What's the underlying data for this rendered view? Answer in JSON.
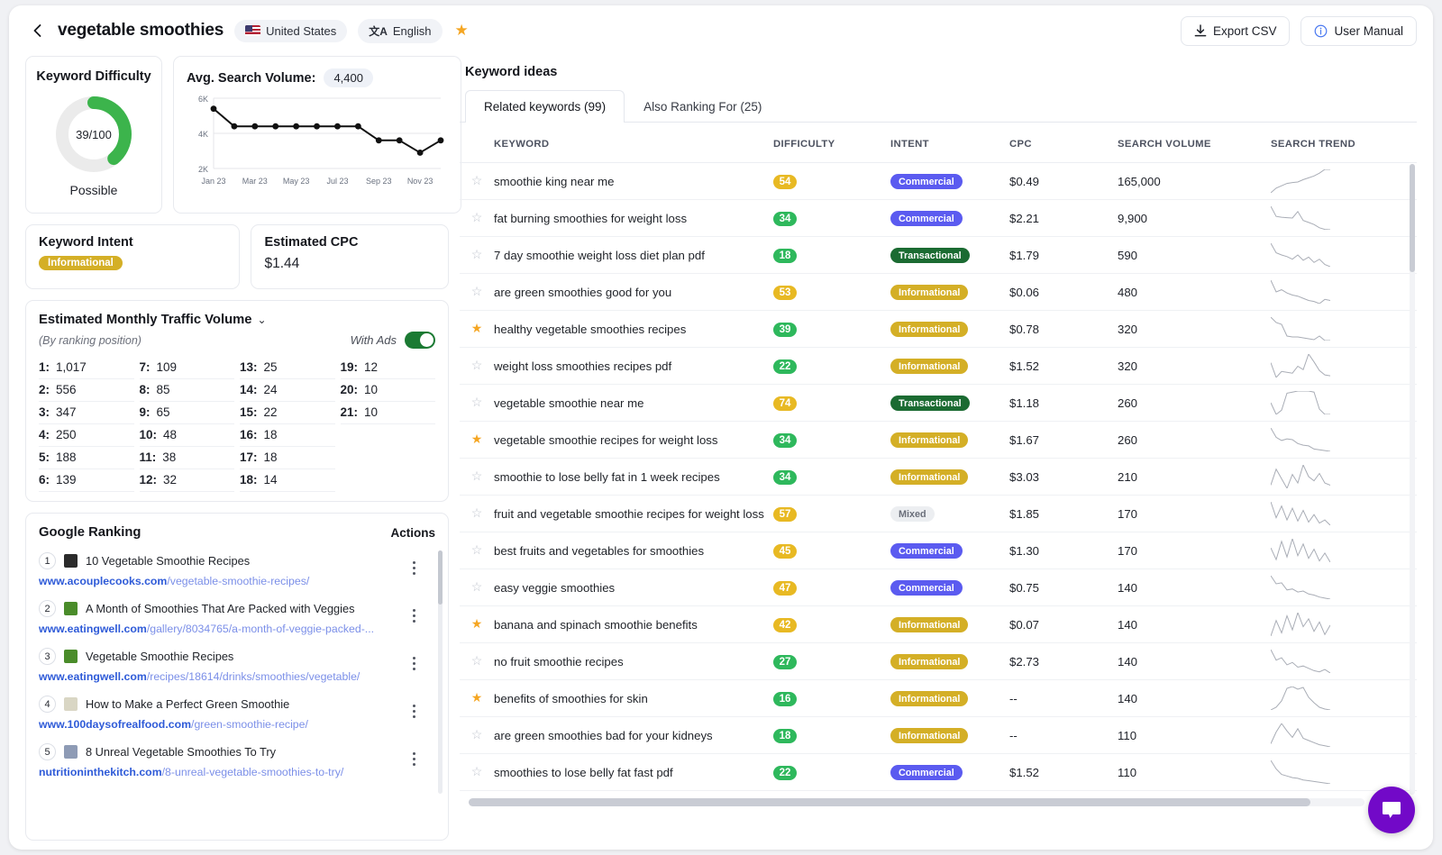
{
  "header": {
    "back_icon": "chevron-left-icon",
    "keyword": "vegetable smoothies",
    "country": "United States",
    "language": "English",
    "favorite_icon": "star-filled-icon",
    "export_label": "Export CSV",
    "manual_label": "User Manual"
  },
  "keyword_difficulty": {
    "title": "Keyword Difficulty",
    "score_text": "39/100",
    "score": 39,
    "verdict": "Possible",
    "arc_color": "#3cb44c",
    "track_color": "#ebebeb"
  },
  "search_volume": {
    "title": "Avg. Search Volume:",
    "value": "4,400"
  },
  "keyword_intent": {
    "title": "Keyword Intent",
    "badge": "Informational",
    "badge_color": "#d4af26"
  },
  "estimated_cpc": {
    "title": "Estimated CPC",
    "value": "$1.44"
  },
  "traffic": {
    "title": "Estimated Monthly Traffic Volume",
    "chevron_icon": "chevron-down-icon",
    "subtitle": "(By ranking position)",
    "ads_label": "With Ads",
    "ads_on": true,
    "columns": [
      [
        {
          "pos": "1:",
          "val": "1,017"
        },
        {
          "pos": "2:",
          "val": "556"
        },
        {
          "pos": "3:",
          "val": "347"
        },
        {
          "pos": "4:",
          "val": "250"
        },
        {
          "pos": "5:",
          "val": "188"
        },
        {
          "pos": "6:",
          "val": "139"
        }
      ],
      [
        {
          "pos": "7:",
          "val": "109"
        },
        {
          "pos": "8:",
          "val": "85"
        },
        {
          "pos": "9:",
          "val": "65"
        },
        {
          "pos": "10:",
          "val": "48"
        },
        {
          "pos": "11:",
          "val": "38"
        },
        {
          "pos": "12:",
          "val": "32"
        }
      ],
      [
        {
          "pos": "13:",
          "val": "25"
        },
        {
          "pos": "14:",
          "val": "24"
        },
        {
          "pos": "15:",
          "val": "22"
        },
        {
          "pos": "16:",
          "val": "18"
        },
        {
          "pos": "17:",
          "val": "18"
        },
        {
          "pos": "18:",
          "val": "14"
        }
      ],
      [
        {
          "pos": "19:",
          "val": "12"
        },
        {
          "pos": "20:",
          "val": "10"
        },
        {
          "pos": "21:",
          "val": "10"
        }
      ]
    ]
  },
  "google_ranking": {
    "title": "Google Ranking",
    "actions_label": "Actions",
    "items": [
      {
        "rank": "1",
        "title": "10 Vegetable Smoothie Recipes",
        "domain": "www.acouplecooks.com",
        "path": "/vegetable-smoothie-recipes/",
        "favicon": "#2b2b2b"
      },
      {
        "rank": "2",
        "title": "A Month of Smoothies That Are Packed with Veggies",
        "domain": "www.eatingwell.com",
        "path": "/gallery/8034765/a-month-of-veggie-packed-...",
        "favicon": "#4a8c2a"
      },
      {
        "rank": "3",
        "title": "Vegetable Smoothie Recipes",
        "domain": "www.eatingwell.com",
        "path": "/recipes/18614/drinks/smoothies/vegetable/",
        "favicon": "#4a8c2a"
      },
      {
        "rank": "4",
        "title": "How to Make a Perfect Green Smoothie",
        "domain": "www.100daysofrealfood.com",
        "path": "/green-smoothie-recipe/",
        "favicon": "#d9d6c4"
      },
      {
        "rank": "5",
        "title": "8 Unreal Vegetable Smoothies To Try",
        "domain": "nutritioninthekitch.com",
        "path": "/8-unreal-vegetable-smoothies-to-try/",
        "favicon": "#8e9bb5"
      }
    ]
  },
  "keyword_ideas": {
    "title": "Keyword ideas",
    "tabs": [
      {
        "label": "Related keywords (99)",
        "active": true
      },
      {
        "label": "Also Ranking For (25)",
        "active": false
      }
    ],
    "columns": [
      "KEYWORD",
      "DIFFICULTY",
      "INTENT",
      "CPC",
      "SEARCH VOLUME",
      "SEARCH TREND"
    ],
    "rows": [
      {
        "starred": false,
        "keyword": "smoothie king near me",
        "difficulty": 54,
        "intent": "Commercial",
        "cpc": "$0.49",
        "volume": "165,000",
        "trend": [
          30,
          40,
          45,
          50,
          52,
          53,
          58,
          62,
          66,
          72,
          80,
          80
        ]
      },
      {
        "starred": false,
        "keyword": "fat burning smoothies for weight loss",
        "difficulty": 34,
        "intent": "Commercial",
        "cpc": "$2.21",
        "volume": "9,900",
        "trend": [
          85,
          60,
          58,
          57,
          56,
          72,
          50,
          45,
          40,
          32,
          28,
          27
        ]
      },
      {
        "starred": false,
        "keyword": "7 day smoothie weight loss diet plan pdf",
        "difficulty": 18,
        "intent": "Transactional",
        "cpc": "$1.79",
        "volume": "590",
        "trend": [
          80,
          62,
          58,
          55,
          50,
          58,
          48,
          54,
          44,
          50,
          40,
          36
        ]
      },
      {
        "starred": false,
        "keyword": "are green smoothies good for you",
        "difficulty": 53,
        "intent": "Informational",
        "cpc": "$0.06",
        "volume": "480",
        "trend": [
          78,
          56,
          60,
          54,
          50,
          48,
          44,
          40,
          38,
          34,
          42,
          40
        ]
      },
      {
        "starred": true,
        "keyword": "healthy vegetable smoothies recipes",
        "difficulty": 39,
        "intent": "Informational",
        "cpc": "$0.78",
        "volume": "320",
        "trend": [
          82,
          70,
          66,
          40,
          38,
          38,
          36,
          34,
          32,
          40,
          30,
          30
        ]
      },
      {
        "starred": false,
        "keyword": "weight loss smoothies recipes pdf",
        "difficulty": 22,
        "intent": "Informational",
        "cpc": "$1.52",
        "volume": "320",
        "trend": [
          68,
          34,
          48,
          46,
          44,
          60,
          52,
          88,
          70,
          50,
          40,
          38
        ]
      },
      {
        "starred": false,
        "keyword": "vegetable smoothie near me",
        "difficulty": 74,
        "intent": "Transactional",
        "cpc": "$1.18",
        "volume": "260",
        "trend": [
          52,
          30,
          38,
          70,
          72,
          74,
          74,
          74,
          72,
          40,
          30,
          30
        ]
      },
      {
        "starred": true,
        "keyword": "vegetable smoothie recipes for weight loss",
        "difficulty": 34,
        "intent": "Informational",
        "cpc": "$1.67",
        "volume": "260",
        "trend": [
          84,
          60,
          52,
          56,
          54,
          44,
          40,
          38,
          30,
          28,
          26,
          24
        ]
      },
      {
        "starred": false,
        "keyword": "smoothie to lose belly fat in 1 week recipes",
        "difficulty": 34,
        "intent": "Informational",
        "cpc": "$3.03",
        "volume": "210",
        "trend": [
          40,
          70,
          52,
          34,
          60,
          44,
          78,
          56,
          48,
          62,
          44,
          40
        ]
      },
      {
        "starred": false,
        "keyword": "fruit and vegetable smoothie recipes for weight loss",
        "difficulty": 57,
        "intent": "Mixed",
        "cpc": "$1.85",
        "volume": "170",
        "trend": [
          74,
          44,
          66,
          40,
          62,
          38,
          58,
          36,
          50,
          34,
          40,
          30
        ]
      },
      {
        "starred": false,
        "keyword": "best fruits and vegetables for smoothies",
        "difficulty": 45,
        "intent": "Commercial",
        "cpc": "$1.30",
        "volume": "170",
        "trend": [
          58,
          40,
          68,
          44,
          72,
          46,
          64,
          42,
          56,
          38,
          50,
          36
        ]
      },
      {
        "starred": false,
        "keyword": "easy veggie smoothies",
        "difficulty": 47,
        "intent": "Commercial",
        "cpc": "$0.75",
        "volume": "140",
        "trend": [
          72,
          56,
          58,
          44,
          46,
          40,
          42,
          36,
          34,
          30,
          28,
          26
        ]
      },
      {
        "starred": true,
        "keyword": "banana and spinach smoothie benefits",
        "difficulty": 42,
        "intent": "Informational",
        "cpc": "$0.07",
        "volume": "140",
        "trend": [
          40,
          60,
          44,
          66,
          48,
          70,
          52,
          62,
          46,
          58,
          42,
          54
        ]
      },
      {
        "starred": false,
        "keyword": "no fruit smoothie recipes",
        "difficulty": 27,
        "intent": "Informational",
        "cpc": "$2.73",
        "volume": "140",
        "trend": [
          66,
          48,
          52,
          40,
          44,
          36,
          38,
          34,
          30,
          28,
          32,
          26
        ]
      },
      {
        "starred": true,
        "keyword": "benefits of smoothies for skin",
        "difficulty": 16,
        "intent": "Informational",
        "cpc": "--",
        "volume": "140",
        "trend": [
          28,
          34,
          48,
          76,
          80,
          74,
          78,
          56,
          44,
          34,
          30,
          28
        ]
      },
      {
        "starred": false,
        "keyword": "are green smoothies bad for your kidneys",
        "difficulty": 18,
        "intent": "Informational",
        "cpc": "--",
        "volume": "110",
        "trend": [
          34,
          56,
          72,
          58,
          46,
          62,
          44,
          40,
          36,
          32,
          30,
          28
        ]
      },
      {
        "starred": false,
        "keyword": "smoothies to lose belly fat fast pdf",
        "difficulty": 22,
        "intent": "Commercial",
        "cpc": "$1.52",
        "volume": "110",
        "trend": [
          80,
          58,
          44,
          40,
          36,
          34,
          30,
          28,
          26,
          24,
          22,
          20
        ]
      }
    ]
  },
  "chat": {
    "icon": "chat-bubble-icon",
    "color": "#7209c8"
  },
  "chart_data": {
    "type": "line",
    "title": "Avg. Search Volume",
    "x": [
      "Jan 23",
      "Feb 23",
      "Mar 23",
      "Apr 23",
      "May 23",
      "Jun 23",
      "Jul 23",
      "Aug 23",
      "Sep 23",
      "Oct 23",
      "Nov 23",
      "Dec 23"
    ],
    "tick_labels": [
      "Jan 23",
      "Mar 23",
      "May 23",
      "Jul 23",
      "Sep 23",
      "Nov 23"
    ],
    "values": [
      5400,
      4400,
      4400,
      4400,
      4400,
      4400,
      4400,
      4400,
      3600,
      3600,
      2900,
      3600
    ],
    "ylabel": "",
    "xlabel": "",
    "ylim": [
      2000,
      6000
    ],
    "yticks": [
      2000,
      4000,
      6000
    ],
    "ytick_labels": [
      "2K",
      "4K",
      "6K"
    ],
    "grid": true,
    "line_color": "#111111",
    "marker": "circle",
    "legend": false
  }
}
